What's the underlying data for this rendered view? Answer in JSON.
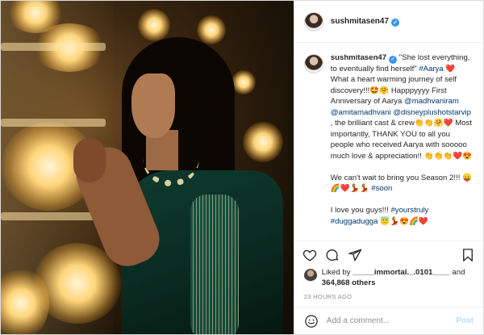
{
  "post": {
    "username": "sushmitasen47",
    "verified": true,
    "caption": {
      "username": "sushmitasen47",
      "paragraphs": [
        [
          {
            "t": "text",
            "v": " \"She lost everything, to eventually find herself\" "
          },
          {
            "t": "link",
            "v": "#Aarya"
          },
          {
            "t": "text",
            "v": " ❤️ What a heart warming journey of self discovery!!!🤩🤗 Happpyyyy First Anniversary of Aarya "
          },
          {
            "t": "link",
            "v": "@madhvaniram"
          },
          {
            "t": "text",
            "v": " "
          },
          {
            "t": "link",
            "v": "@amitamadhvani"
          },
          {
            "t": "text",
            "v": " "
          },
          {
            "t": "link",
            "v": "@disneyplushotstarvip"
          },
          {
            "t": "text",
            "v": " , the brilliant cast & crew👏👏🤗❤️ Most importantly, THANK YOU to all you people who received Aarya with sooooo much love & appreciation!! 👏👏👏❤️😍"
          }
        ],
        [
          {
            "t": "text",
            "v": "We can't wait to bring you Season 2!!! 😛🌈❤️💃💃 "
          },
          {
            "t": "link",
            "v": "#soon"
          }
        ],
        [
          {
            "t": "text",
            "v": "I love you guys!!! "
          },
          {
            "t": "link",
            "v": "#yourstruly"
          },
          {
            "t": "text",
            "v": " "
          },
          {
            "t": "link",
            "v": "#duggadugga"
          },
          {
            "t": "text",
            "v": " 😇💃😍🌈❤️"
          }
        ]
      ]
    },
    "icons": {
      "like": "heart-icon",
      "comment": "comment-icon",
      "share": "share-icon",
      "save": "bookmark-icon",
      "emoji": "emoji-icon"
    },
    "likes": {
      "prefix": "Liked by ",
      "user": "_____immortal._.0101____",
      "middle": " and",
      "count": "364,868 others"
    },
    "timestamp": "23 HOURS AGO",
    "comment_box": {
      "placeholder": "Add a comment...",
      "post_label": "Post"
    }
  }
}
